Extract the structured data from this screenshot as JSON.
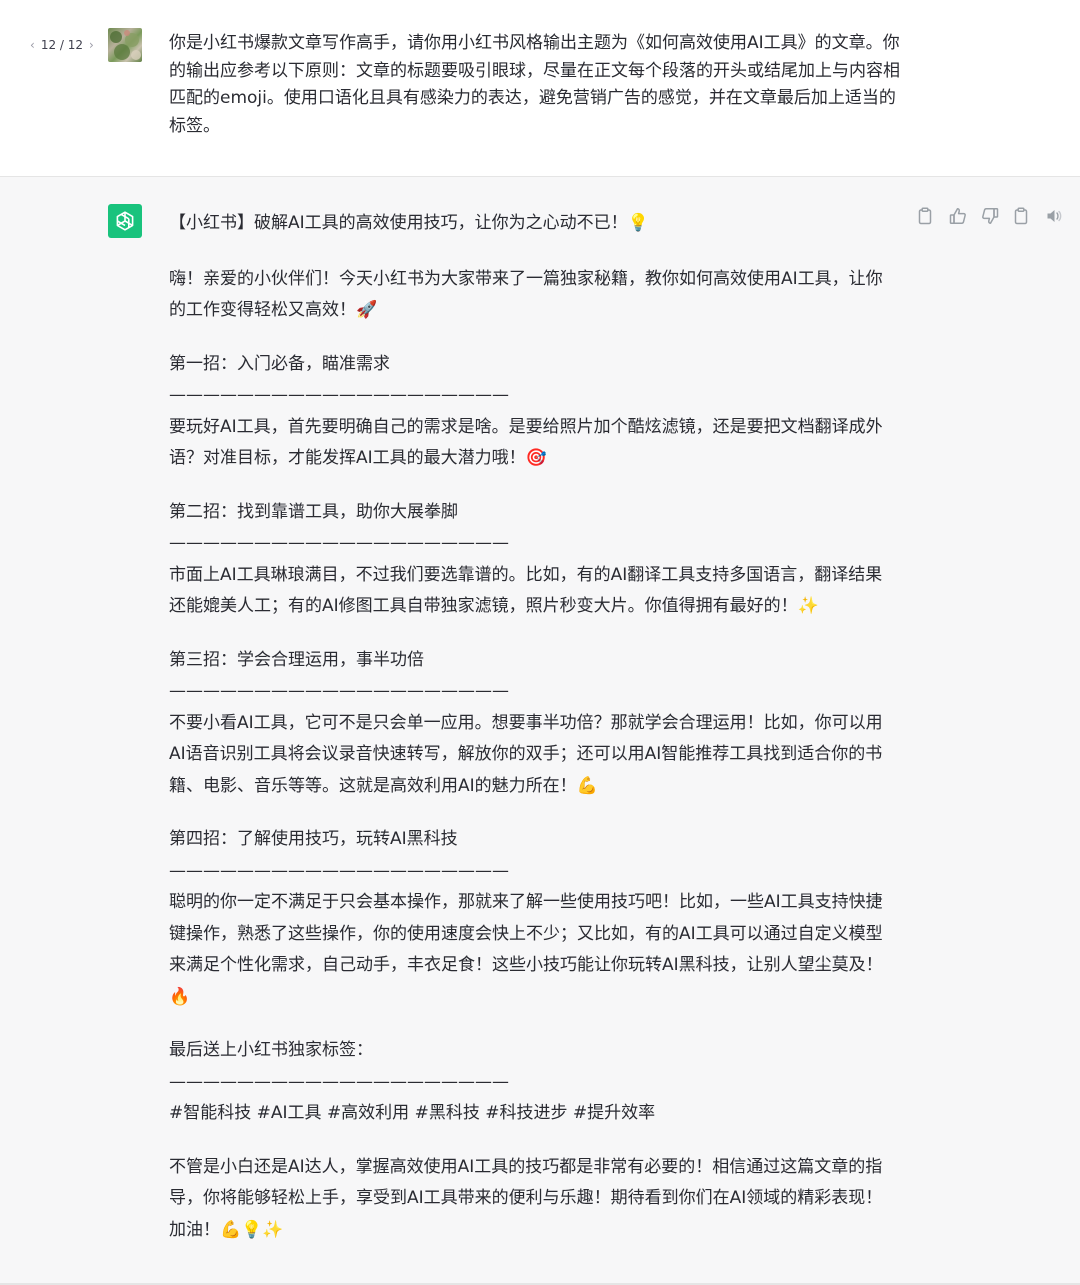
{
  "pager": {
    "text": "12 / 12",
    "prev_icon": "chevron-left-icon",
    "next_icon": "chevron-right-icon"
  },
  "user": {
    "avatar": "user-avatar-photo",
    "message": "你是小红书爆款文章写作高手，请你用小红书风格输出主题为《如何高效使用AI工具》的文章。你的输出应参考以下原则：文章的标题要吸引眼球，尽量在正文每个段落的开头或结尾加上与内容相匹配的emoji。使用口语化且具有感染力的表达，避免营销广告的感觉，并在文章最后加上适当的标签。"
  },
  "assistant": {
    "avatar": "openai-logo-icon",
    "accent_color": "#19c37d",
    "actions": [
      "copy-icon",
      "thumbs-up-icon",
      "thumbs-down-icon",
      "clipboard-icon",
      "speaker-icon"
    ],
    "title": "【小红书】破解AI工具的高效使用技巧，让你为之心动不已！💡",
    "intro": "嗨！亲爱的小伙伴们！今天小红书为大家带来了一篇独家秘籍，教你如何高效使用AI工具，让你的工作变得轻松又高效！🚀",
    "divider": "————————————————————",
    "sections": [
      {
        "heading": "第一招：入门必备，瞄准需求",
        "body": "要玩好AI工具，首先要明确自己的需求是啥。是要给照片加个酷炫滤镜，还是要把文档翻译成外语？对准目标，才能发挥AI工具的最大潜力哦！🎯"
      },
      {
        "heading": "第二招：找到靠谱工具，助你大展拳脚",
        "body": "市面上AI工具琳琅满目，不过我们要选靠谱的。比如，有的AI翻译工具支持多国语言，翻译结果还能媲美人工；有的AI修图工具自带独家滤镜，照片秒变大片。你值得拥有最好的！✨"
      },
      {
        "heading": "第三招：学会合理运用，事半功倍",
        "body": "不要小看AI工具，它可不是只会单一应用。想要事半功倍？那就学会合理运用！比如，你可以用AI语音识别工具将会议录音快速转写，解放你的双手；还可以用AI智能推荐工具找到适合你的书籍、电影、音乐等等。这就是高效利用AI的魅力所在！💪"
      },
      {
        "heading": "第四招：了解使用技巧，玩转AI黑科技",
        "body": "聪明的你一定不满足于只会基本操作，那就来了解一些使用技巧吧！比如，一些AI工具支持快捷键操作，熟悉了这些操作，你的使用速度会快上不少；又比如，有的AI工具可以通过自定义模型来满足个性化需求，自己动手，丰衣足食！这些小技巧能让你玩转AI黑科技，让别人望尘莫及！🔥"
      },
      {
        "heading": "最后送上小红书独家标签：",
        "body": "#智能科技 #AI工具 #高效利用 #黑科技 #科技进步 #提升效率"
      }
    ],
    "closing": "不管是小白还是AI达人，掌握高效使用AI工具的技巧都是非常有必要的！相信通过这篇文章的指导，你将能够轻松上手，享受到AI工具带来的便利与乐趣！期待看到你们在AI领域的精彩表现！加油！💪💡✨"
  }
}
